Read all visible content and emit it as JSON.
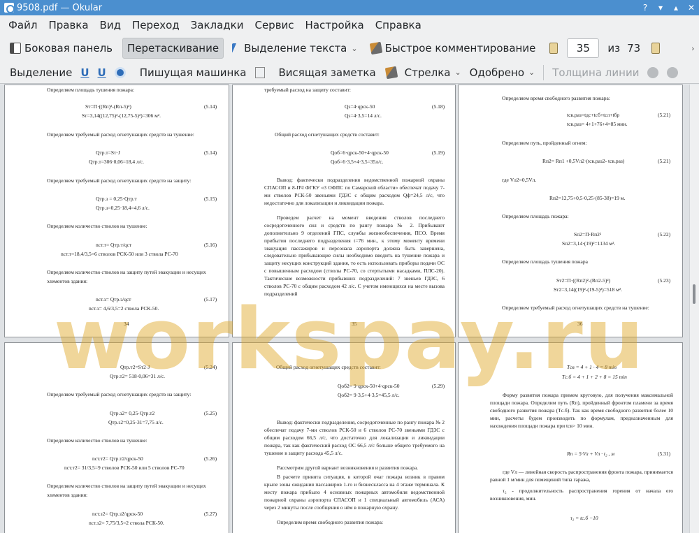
{
  "window": {
    "title": "9508.pdf  — Okular",
    "accent": "#4b8fcf"
  },
  "menu": [
    "Файл",
    "Правка",
    "Вид",
    "Переход",
    "Закладки",
    "Сервис",
    "Настройка",
    "Справка"
  ],
  "toolbar1": {
    "sidebar_label": "Боковая панель",
    "drag_label": "Перетаскивание",
    "text_select_label": "Выделение текста",
    "quick_comment_label": "Быстрое комментирование",
    "page_current": "35",
    "page_of": "из",
    "page_total": "73"
  },
  "toolbar2": {
    "selection_label": "Выделение",
    "typewriter_label": "Пишущая машинка",
    "note_label": "Висящая заметка",
    "arrow_label": "Стрелка",
    "stamp_label": "Одобрено",
    "line_width_label": "Толщина линии"
  },
  "watermark": "workspay.ru",
  "pages": {
    "p34": {
      "l1": "Определяем площадь тушения пожара:",
      "eq1": "Sт=П·((Rп)²-(Rп-5)²)",
      "eq1_no": "(5.14)",
      "eq1b": "Sт=3,14((12,75)²-(12,75-5)²)=306 м².",
      "l2": "Определяем требуемый расход огнетушащих средств на тушение:",
      "eq2": "Qтр.т=Sт·J",
      "eq2_no": "(5.14)",
      "eq2b": "Qтр.т=306·0,06=18,4 л/с.",
      "l3": "Определяем требуемый расход огнетушащих средств на защиту:",
      "eq3": "Qтр.з = 0,25·Qтр.т",
      "eq3_no": "(5.15)",
      "eq3b": "Qтр.з=0,25·18,4=4,6 л/с.",
      "l4": "Определяем количество стволов на тушение:",
      "eq4": "nст.т= Qтр.т/qст",
      "eq4_no": "(5.16)",
      "eq4b": "nст.т=18,4/3,5=6 стволов РСК-50 или 3 ствола РС-70",
      "l5": "Определяем количество стволов на защиту путей эвакуации и несущих",
      "l6": "элементов здания:",
      "eq5": "nст.з= Qтр.з/qст",
      "eq5_no": "(5.17)",
      "eq5b": "nст.з= 4,6/3,5=2 ствола РСК-50.",
      "num": "34"
    },
    "p35": {
      "l1": "требуемый расход на защиту составит:",
      "eq1": "Qз=4·qрск-50",
      "eq1_no": "(5.18)",
      "eq1b": "Qз=4·3,5=14 л/с.",
      "l2": "Общий расход огнетушащих средств составит:",
      "eq2": "Qоб=6·qрск-50+4·qрск-50",
      "eq2_no": "(5.19)",
      "eq2b": "Qоб=6·3,5+4·3,5=35л/с.",
      "para1": "Вывод: фактически подразделения ведомственной пожарной охраны СПАСОП и 8-ПЧ ФГКУ «3 ОФПС по Самарской области» обеспечат подачу 7-ми стволов РСК-50 звеньями ГДЗС с общим расходом Qф=24,5 л/с, что недостаточно для локализации и ликвидации пожара.",
      "para2": "Проведем расчет на момент введения стволов последнего сосредоточенного сил и средств по рангу пожара № 2. Прибывают дополнительно 9 отделений ГПС, службы жизнеобеспечения, ПСО. Время прибытия последнего подразделения t=76 мин., к этому моменту времени эвакуация пассажиров и персонала аэропорта должна быть завершена, следовательно прибывающие силы необходимо вводить на тушение пожара и защиту несущих конструкций здания, то есть использовать приборы подачи ОС с повышенным расходом (стволы РС-70, со стертытыми насадками, ПЛС-20). Тактические возможности прибывших подразделений: 7 звеньев ГДЗС, 6 стволов РС-70 с общим расходом 42 л/с. С учетом имеющихся на месте вызова подразделений",
      "num": "35"
    },
    "p36": {
      "l1": "Определяем время свободного развития пожара:",
      "eq1": "tсв.раз=tдс+tсб+tсл+tбр",
      "eq1_no": "(5.21)",
      "eq1b": "tсв.раз= 4+1+76+4=85 мин.",
      "l2": "Определяем путь, пройденный огнем:",
      "eq2": "Rп2= Rп1 +0,5Vл2·(tсв.раз2- tсв.раз)",
      "eq2_no": "(5.21)",
      "l3": "где Vл2=0,5Vл.",
      "eq2b": "Rп2=12,75+0,5·0,25·(85-38)=19 м.",
      "l4": "Определяем площадь пожара:",
      "eq3": "Sп2=П·Rп2²",
      "eq3_no": "(5.22)",
      "eq3b": "Sп2=3,14·(19)²=1134 м².",
      "l5": "Определяем площадь тушения пожара",
      "eq4": "Sт2=П·((Rп2)²-(Rп2-5)²)",
      "eq4_no": "(5.23)",
      "eq4b": "Sт2=3,14((19)²-(19-5)²)=518 м².",
      "l6": "Определяем требуемый расход огнетушащих средств на тушение:",
      "num": "36"
    },
    "p37": {
      "eq1": "Qтр.т2=Sт2·J",
      "eq1_no": "(5.24)",
      "eq1b": "Qтр.т2= 518·0,06=31 л/с.",
      "l1": "Определяем требуемый расход огнетушащих средств на защиту:",
      "eq2": "Qтр.з2= 0,25·Qтр.т2",
      "eq2_no": "(5.25)",
      "eq2b": "Qтр.з2=0,25·31=7,75 л/с.",
      "l2": "Определяем количество стволов на тушение:",
      "eq3": "nст.т2= Qтр.т2/qрск-50",
      "eq3_no": "(5.26)",
      "eq3b": "nст.т2= 31/3,5=9 стволов РСК-50 или 5 стволов РС-70",
      "l3": "Определяем количество стволов на защиту путей эвакуации и несущих",
      "l4": "элементов здания:",
      "eq4": "nст.з2= Qтр.з2/qрск-50",
      "eq4_no": "(5.27)",
      "eq4b": "nст.з2= 7,75/3,5=2 ствола РСК-50."
    },
    "p38": {
      "l1": "Общий расход огнетушащих средств составит:",
      "eq1": "Qоб2= 9·qрск-50+4·qрск-50",
      "eq1_no": "(5.29)",
      "eq1b": "Qоб2= 9·3,5+4·3,5=45,5 л/с.",
      "para1": "Вывод: фактически подразделения, сосредоточенные по рангу пожара № 2 обеспечат подачу 7-ми стволов РСК-50 и 6 стволов РС-70 звеньями ГДЗС с общим расходом 66,5 л/с, что достаточно для локализации и ликвидации пожара, так как фактический расход ОС 66,5 л/с больше общего требуемого на тушение в защиту расхода 45,5 л/с.",
      "para2": "Рассмотрим другой вариант возникновения и развития пожара.",
      "para3": "В расчете принята ситуация, в которой очаг пожара возник в правом крыле зоны ожидания пассажиров 1-го и бизнескласса на 4 этаже терминала. К месту пожара прибыло 4 основных пожарных автомобиля ведомственной пожарной охраны аэропорта СПАСОП и 1 специальный автомобиль (АСА) через 2 минуты после сообщения о нём в пожарную охрану.",
      "para4": "Определим время свободного развития пожара:"
    },
    "p39": {
      "eq1": "Tсв = 4 + 1 · 4 = 8 min",
      "eq1b": "Tс.б = 4 + 1 + 2 + 8 = 15 min",
      "para1": "Форму развития пожара примем круговую, для получения максимальной площади пожара. Определим путь (Rп), пройденный фронтом пламени за время свободного развития пожара (Tс.б). Так как время свободного развития более 10 мин, расчеты будем производить по формулам, предназначенным для нахождения площади пожара при tсв> 10 мин.",
      "eq2": "Rп = 5·Vл + Vл · t₂ , м",
      "eq2_no": "(5.31)",
      "para2": "где Vл — линейная скорость распространения фронта пожара, принимается равной 1 м/мин для помещений типа гаража,",
      "para3": "τ₂ - продолжительность распространения горения от начала его возникновения, мин.",
      "eq3": "τ₂ = tс.б −10"
    }
  }
}
